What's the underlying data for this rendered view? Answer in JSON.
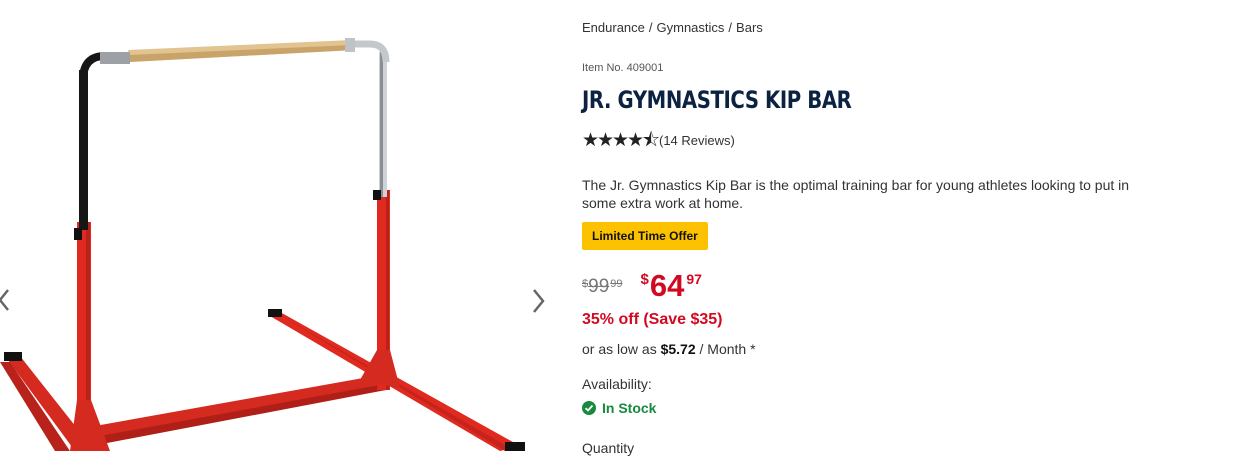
{
  "breadcrumb": [
    "Endurance",
    "Gymnastics",
    "Bars"
  ],
  "breadcrumb_separator": "/",
  "product": {
    "item_number": "Item No. 409001",
    "title": "JR. GYMNASTICS KIP BAR",
    "rating": 4.5,
    "reviews": "(14 Reviews)",
    "description": "The Jr. Gymnastics Kip Bar is the optimal training bar for young athletes looking to put in some extra work at home.",
    "offer_badge": "Limited Time Offer",
    "old_price": {
      "currency": "$",
      "dollars": "99",
      "cents": "99"
    },
    "new_price": {
      "currency": "$",
      "dollars": "64",
      "cents": "97"
    },
    "savings": "35% off (Save $35)",
    "financing": {
      "prefix": "or as low as",
      "amount": "$5.72",
      "suffix": "/ Month *"
    },
    "availability_label": "Availability:",
    "stock_status": "In Stock",
    "quantity_label": "Quantity"
  },
  "icons": {
    "prev": "chevron-left-icon",
    "next": "chevron-right-icon",
    "stock": "check-circle-icon",
    "stars": "star-icon"
  },
  "colors": {
    "title": "#0b2341",
    "sale_price": "#d10a22",
    "badge": "#fcc200",
    "in_stock": "#168a3d",
    "bar_frame": "#e0291f"
  }
}
